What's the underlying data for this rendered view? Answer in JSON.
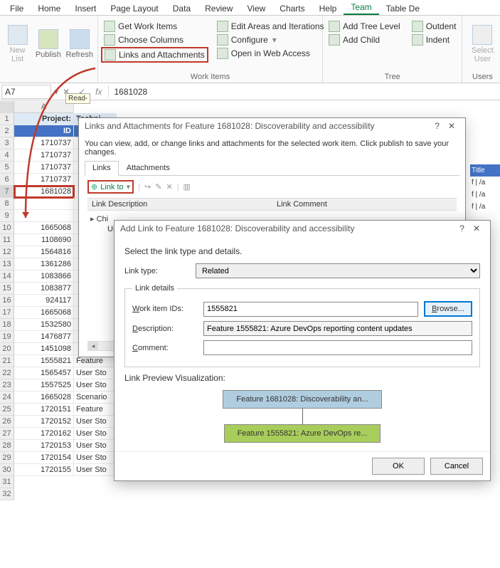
{
  "tabs": [
    "File",
    "Home",
    "Insert",
    "Page Layout",
    "Data",
    "Review",
    "View",
    "Charts",
    "Help",
    "Team",
    "Table De"
  ],
  "active_tab_index": 9,
  "ribbon": {
    "list_group": {
      "new_list": "New\nList",
      "publish": "Publish",
      "refresh": "Refresh"
    },
    "work_items": {
      "get": "Get Work Items",
      "choose": "Choose Columns",
      "links": "Links and Attachments",
      "edit_areas": "Edit Areas and Iterations",
      "configure": "Configure",
      "open_web": "Open in Web Access",
      "label": "Work Items"
    },
    "tree": {
      "add_level": "Add Tree Level",
      "add_child": "Add Child",
      "outdent": "Outdent",
      "indent": "Indent",
      "label": "Tree"
    },
    "users": {
      "select_user": "Select\nUser",
      "label": "Users"
    }
  },
  "namebox": {
    "cell": "A7",
    "formula": "1681028"
  },
  "columns": {
    "A": "A"
  },
  "sheet": {
    "project_label": "Project:",
    "project_value": "Techni",
    "id_header": "ID",
    "title_header": "Title",
    "rows": [
      {
        "id": "1710737",
        "b": ""
      },
      {
        "id": "1710737",
        "b": ""
      },
      {
        "id": "1710737",
        "b": ""
      },
      {
        "id": "1710737",
        "b": ""
      },
      {
        "id": "1681028",
        "b": ""
      },
      {
        "id": "",
        "b": ""
      },
      {
        "id": "",
        "b": ""
      },
      {
        "id": "1665068",
        "b": ""
      },
      {
        "id": "1108690",
        "b": ""
      },
      {
        "id": "1564816",
        "b": ""
      },
      {
        "id": "1361286",
        "b": ""
      },
      {
        "id": "1083866",
        "b": ""
      },
      {
        "id": "1083877",
        "b": ""
      },
      {
        "id": "924117",
        "b": ""
      },
      {
        "id": "1665068",
        "b": ""
      },
      {
        "id": "1532580",
        "b": ""
      },
      {
        "id": "1476877",
        "b": ""
      },
      {
        "id": "1451098",
        "b": ""
      },
      {
        "id": "1555821",
        "b": "Feature"
      },
      {
        "id": "1565457",
        "b": "User Sto"
      },
      {
        "id": "1557525",
        "b": "User Sto"
      },
      {
        "id": "1665028",
        "b": "Scenario"
      },
      {
        "id": "1720151",
        "b": "Feature"
      },
      {
        "id": "1720152",
        "b": "User Sto"
      },
      {
        "id": "1720162",
        "b": "User Sto"
      },
      {
        "id": "1720153",
        "b": "User Sto"
      },
      {
        "id": "1720154",
        "b": "User Sto"
      },
      {
        "id": "1720155",
        "b": "User Sto"
      }
    ],
    "tooltip": "Read-",
    "title_frags": [
      "f | /a",
      "f | /a",
      "f | /a"
    ]
  },
  "dialog1": {
    "title": "Links and Attachments for Feature 1681028: Discoverability and accessibility",
    "help_text": "You can view, add, or change links and attachments for the selected work item. Click publish to save your changes.",
    "tab_links": "Links",
    "tab_attach": "Attachments",
    "link_to": "Link to",
    "col_desc": "Link Description",
    "col_comment": "Link Comment",
    "row1": "Chi",
    "row2": "Us"
  },
  "dialog2": {
    "title": "Add Link to Feature 1681028: Discoverability and accessibility",
    "instruction": "Select the link type and details.",
    "link_type_label": "Link type:",
    "link_type_value": "Related",
    "fieldset": "Link details",
    "work_item_ids_label": "Work item IDs:",
    "work_item_ids_value": "1555821",
    "browse": "Browse...",
    "description_label": "Description:",
    "description_value": "Feature 1555821: Azure DevOps reporting content updates",
    "comment_label": "Comment:",
    "comment_value": "",
    "preview_label": "Link Preview Visualization:",
    "node1": "Feature 1681028: Discoverability an...",
    "node2": "Feature 1555821: Azure DevOps re...",
    "ok": "OK",
    "cancel": "Cancel"
  }
}
